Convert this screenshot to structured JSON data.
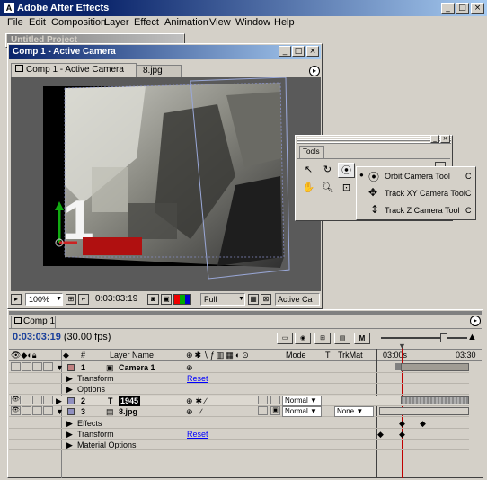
{
  "app": {
    "title": "Adobe After Effects"
  },
  "menu": [
    "File",
    "Edit",
    "Composition",
    "Layer",
    "Effect",
    "Animation",
    "View",
    "Window",
    "Help"
  ],
  "bg_window": {
    "title": "Untitled Project"
  },
  "comp_window": {
    "title": "Comp 1 - Active Camera",
    "tabs": [
      "Comp 1 - Active Camera",
      "8.jpg"
    ],
    "zoom": "100%",
    "timecode": "0:03:03:19",
    "resolution": "Full",
    "camera_view": "Active Ca",
    "overlay_text": "1",
    "colors": {
      "bg": "#5a5a5a",
      "canvas": "#000000"
    }
  },
  "tools": {
    "title": "Tools",
    "flyout": [
      {
        "label": "Orbit Camera Tool",
        "shortcut": "C",
        "selected": true,
        "icon": "orbit-camera-icon"
      },
      {
        "label": "Track XY Camera Tool",
        "shortcut": "C",
        "selected": false,
        "icon": "track-xy-icon"
      },
      {
        "label": "Track Z Camera Tool",
        "shortcut": "C",
        "selected": false,
        "icon": "track-z-icon"
      }
    ]
  },
  "timeline": {
    "tab": "Comp 1",
    "timecode": "0:03:03:19",
    "fps": "(30.00 fps)",
    "ruler": [
      "03:00s",
      "03:30"
    ],
    "columns": {
      "num": "#",
      "layer_name": "Layer Name",
      "mode": "Mode",
      "t": "T",
      "trkmat": "TrkMat"
    },
    "layers": [
      {
        "num": "1",
        "name": "Camera 1",
        "kind": "camera",
        "color": "#c08080",
        "children": [
          "Transform",
          "Options"
        ],
        "mode": "",
        "trkmat": ""
      },
      {
        "num": "2",
        "name": "1945",
        "kind": "text",
        "color": "#9090c0",
        "children": [],
        "mode": "Normal",
        "trkmat": ""
      },
      {
        "num": "3",
        "name": "8.jpg",
        "kind": "footage",
        "color": "#9090c0",
        "children": [
          "Effects",
          "Transform",
          "Material Options"
        ],
        "mode": "Normal",
        "trkmat": "None"
      }
    ],
    "reset_label": "Reset"
  }
}
